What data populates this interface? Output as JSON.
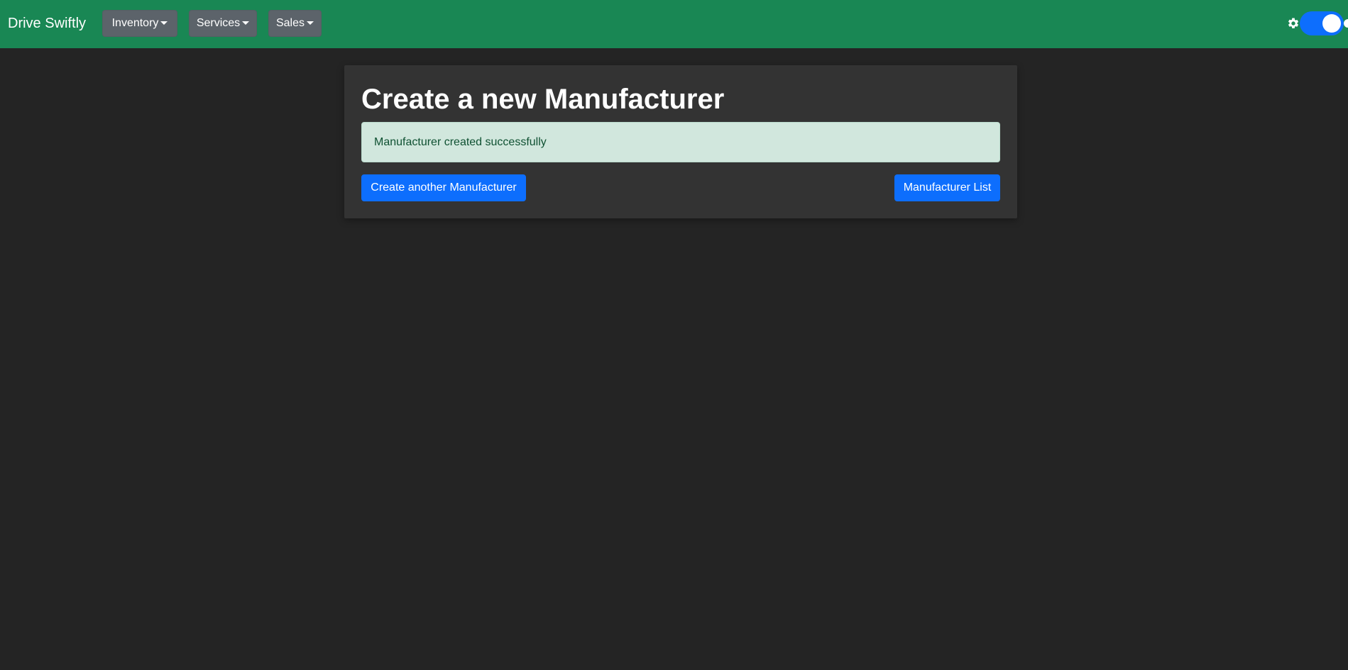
{
  "navbar": {
    "brand": "Drive Swiftly",
    "menus": [
      {
        "label": "Inventory"
      },
      {
        "label": "Services"
      },
      {
        "label": "Sales"
      }
    ],
    "theme_toggle": {
      "icon": "gear-icon",
      "state": "on"
    },
    "background_color": "#198754"
  },
  "main": {
    "title": "Create a new Manufacturer",
    "alert": {
      "message": "Manufacturer created successfully",
      "type": "success"
    },
    "buttons": {
      "create_another": "Create another Manufacturer",
      "list": "Manufacturer List"
    }
  },
  "colors": {
    "page_background": "#242424",
    "card_background": "#333333",
    "primary": "#0d6efd",
    "success_bg": "#d1e7dd",
    "success_text": "#0f5132"
  }
}
